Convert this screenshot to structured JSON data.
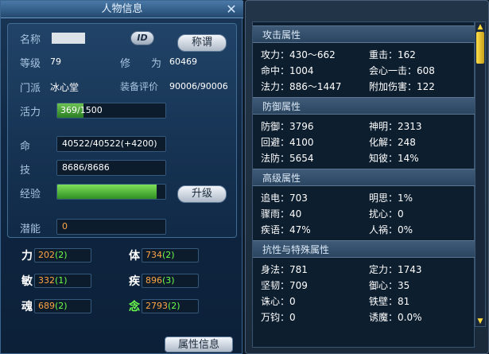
{
  "window": {
    "title": "人物信息",
    "close_icon": "close-x-icon"
  },
  "profile": {
    "name_label": "名称",
    "id_badge": "ID",
    "title_button": "称谓",
    "level_label": "等级",
    "level_value": "79",
    "cultivation_label": "修　　为",
    "cultivation_value": "60469",
    "sect_label": "门派",
    "sect_value": "冰心堂",
    "gear_label": "装备评价",
    "gear_value": "90006/90006",
    "vigor_label": "活力",
    "vigor_value": "369/1500",
    "vigor_fraction": 0.246,
    "hp_label": "命",
    "hp_value": "40522/40522(+4200)",
    "skill_label": "技",
    "skill_value": "8686/8686",
    "exp_label": "经验",
    "exp_fraction": 0.92,
    "upgrade_button": "升级",
    "potential_label": "潜能",
    "potential_value": "0"
  },
  "stats": [
    {
      "name": "力",
      "value": "202",
      "bonus": "(2)"
    },
    {
      "name": "体",
      "value": "734",
      "bonus": "(2)"
    },
    {
      "name": "敏",
      "value": "332",
      "bonus": "(1)"
    },
    {
      "name": "疾",
      "value": "896",
      "bonus": "(3)"
    },
    {
      "name": "魂",
      "value": "689",
      "bonus": "(2)"
    },
    {
      "name": "念",
      "value": "2793",
      "bonus": "(2)"
    }
  ],
  "attr_info_button": "属性信息",
  "right": {
    "sections": [
      {
        "title": "攻击属性",
        "rows": [
          [
            "攻力：430～662",
            "重击：162"
          ],
          [
            "命中：1004",
            "会心一击：608"
          ],
          [
            "法力：886～1447",
            "附加伤害：122"
          ]
        ]
      },
      {
        "title": "防御属性",
        "rows": [
          [
            "防御：3796",
            "神明：2313"
          ],
          [
            "回避：4100",
            "化解：248"
          ],
          [
            "法防：5654",
            "知彼：14%"
          ]
        ]
      },
      {
        "title": "高级属性",
        "rows": [
          [
            "追电：703",
            "明思：1%"
          ],
          [
            "骤雨：40",
            "扰心：0"
          ],
          [
            "疾语：47%",
            "人祸：0%"
          ]
        ]
      },
      {
        "title": "抗性与特殊属性",
        "rows": [
          [
            "身法：781",
            "定力：1743"
          ],
          [
            "坚韧：709",
            "御心：35"
          ],
          [
            "诛心：0",
            "铁壁：81"
          ],
          [
            "万钧：0",
            "诱魔：0.0%"
          ]
        ]
      }
    ]
  },
  "colors": {
    "stat_value": "#ffa545",
    "stat_bonus": "#6cff4c",
    "green_stat_name": "#6cff4c"
  }
}
